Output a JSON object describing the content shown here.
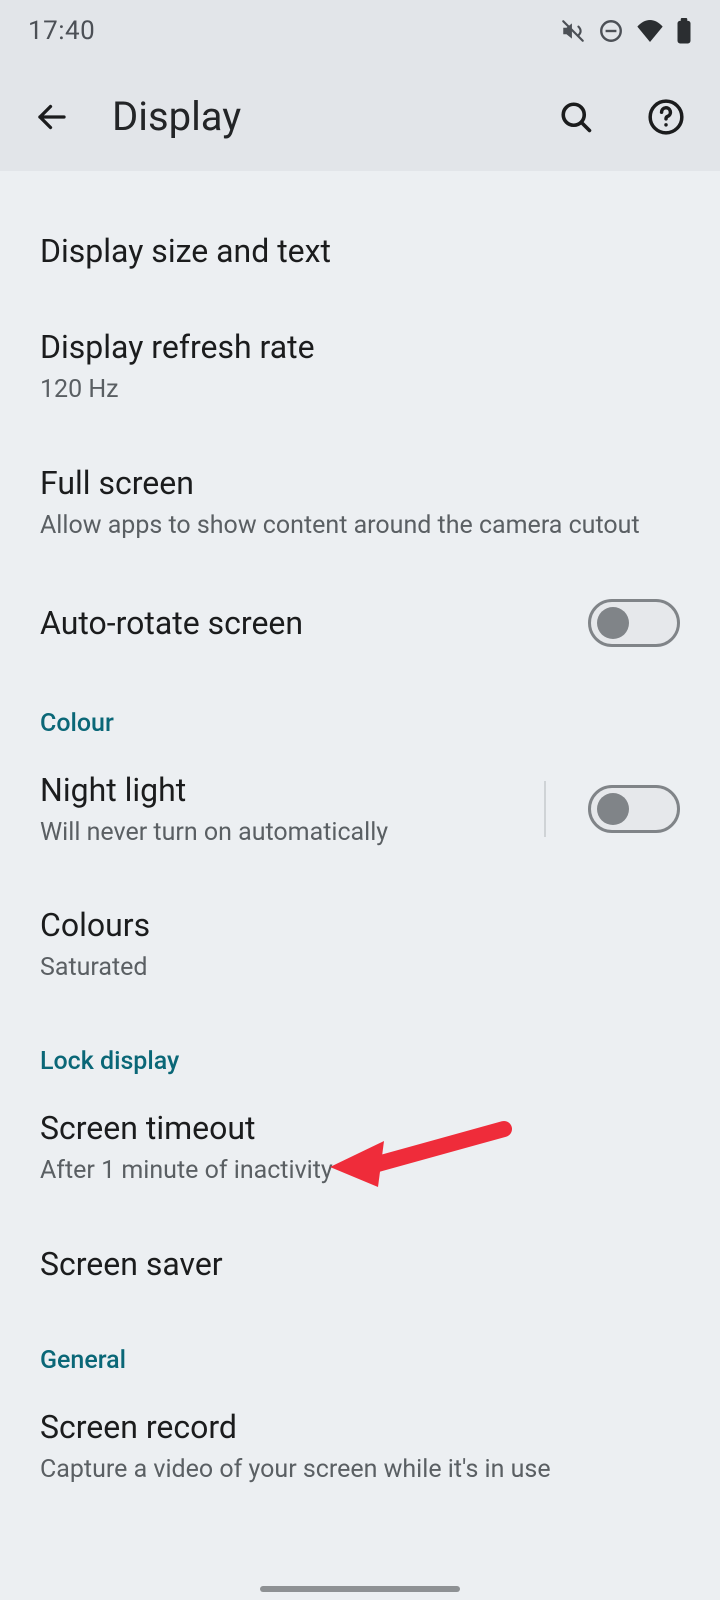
{
  "status": {
    "time": "17:40"
  },
  "header": {
    "title": "Display"
  },
  "items": [
    {
      "title": "Display size and text"
    },
    {
      "title": "Display refresh rate",
      "subtitle": "120 Hz"
    },
    {
      "title": "Full screen",
      "subtitle": "Allow apps to show content around the camera cutout"
    },
    {
      "title": "Auto-rotate screen",
      "toggle": false
    }
  ],
  "sections": [
    {
      "header": "Colour",
      "items": [
        {
          "title": "Night light",
          "subtitle": "Will never turn on automatically",
          "toggle": false,
          "divider": true
        },
        {
          "title": "Colours",
          "subtitle": "Saturated"
        }
      ]
    },
    {
      "header": "Lock display",
      "items": [
        {
          "title": "Screen timeout",
          "subtitle": "After 1 minute of inactivity"
        },
        {
          "title": "Screen saver"
        }
      ]
    },
    {
      "header": "General",
      "items": [
        {
          "title": "Screen record",
          "subtitle": "Capture a video of your screen while it's in use"
        }
      ]
    }
  ],
  "colors": {
    "accent": "#0a6777",
    "arrow": "#ef2c3a"
  }
}
